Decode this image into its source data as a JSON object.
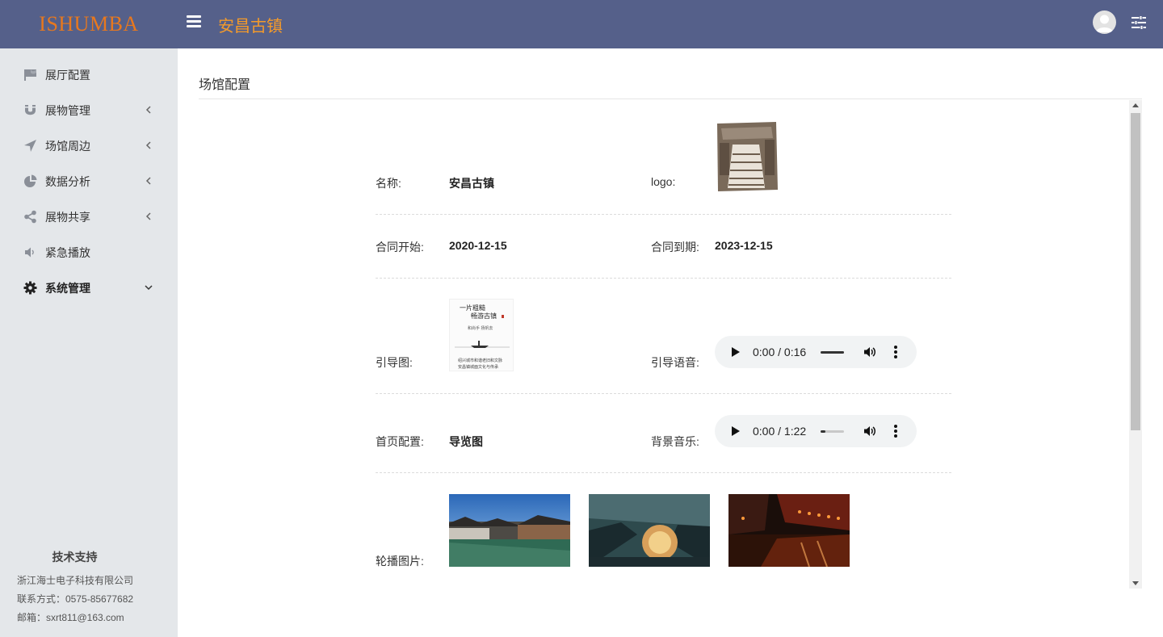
{
  "header": {
    "brand": "ISHUMBA",
    "title": "安昌古镇",
    "brand_color": "#e8781e",
    "title_color": "#f39a2b",
    "bar_color": "#55608a"
  },
  "sidebar": {
    "items": [
      {
        "label": "展厅配置",
        "icon": "flag-icon",
        "expandable": false
      },
      {
        "label": "展物管理",
        "icon": "magnet-icon",
        "expandable": true
      },
      {
        "label": "场馆周边",
        "icon": "location-arrow-icon",
        "expandable": true
      },
      {
        "label": "数据分析",
        "icon": "pie-chart-icon",
        "expandable": true
      },
      {
        "label": "展物共享",
        "icon": "share-icon",
        "expandable": true
      },
      {
        "label": "紧急播放",
        "icon": "volume-icon",
        "expandable": false
      },
      {
        "label": "系统管理",
        "icon": "gear-icon",
        "expandable": true,
        "active": true
      }
    ],
    "support": {
      "title": "技术支持",
      "company": "浙江海士电子科技有限公司",
      "contact": "联系方式：0575-85677682",
      "email": "邮箱：sxrt811@163.com"
    }
  },
  "main": {
    "page_title": "场馆配置",
    "fields": {
      "name_label": "名称:",
      "name_value": "安昌古镇",
      "logo_label": "logo:",
      "contract_start_label": "合同开始:",
      "contract_start_value": "2020-12-15",
      "contract_end_label": "合同到期:",
      "contract_end_value": "2023-12-15",
      "guide_image_label": "引导图:",
      "guide_voice_label": "引导语音:",
      "home_config_label": "首页配置:",
      "home_config_value": "导览图",
      "bg_music_label": "背景音乐:",
      "carousel_label": "轮播图片:"
    },
    "guide_image_text": {
      "line1": "一片粗糙",
      "line2": "畅游古镇",
      "line3": "和尚手 扬帆去",
      "footer1": "绍兴城市和谐老旧和文脉",
      "footer2": "安昌镇城面文化与传承"
    },
    "audio_guide": {
      "time": "0:00 / 0:16",
      "progress": 0,
      "volume": 1.0
    },
    "audio_music": {
      "time": "0:00 / 1:22",
      "progress": 0,
      "volume": 0.2
    }
  }
}
